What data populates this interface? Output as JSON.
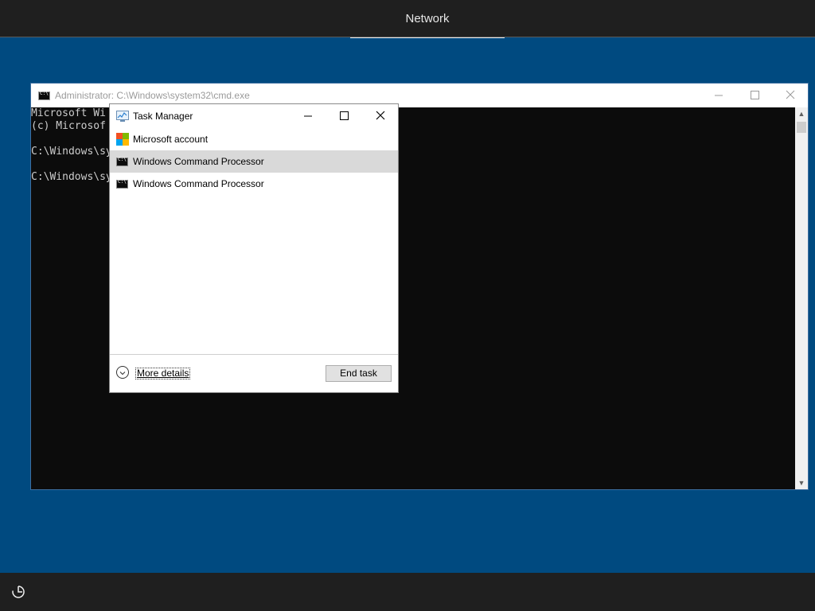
{
  "top_bar": {
    "tab_label": "Network"
  },
  "cmd_window": {
    "title": "Administrator: C:\\Windows\\system32\\cmd.exe",
    "lines": [
      "Microsoft Wi",
      "(c) Microsof",
      "",
      "C:\\Windows\\sy",
      "",
      "C:\\Windows\\sy"
    ]
  },
  "task_manager": {
    "title": "Task Manager",
    "items": [
      {
        "label": "Microsoft account",
        "icon": "microsoft-logo-icon",
        "selected": false
      },
      {
        "label": "Windows Command Processor",
        "icon": "cmd-icon",
        "selected": true
      },
      {
        "label": "Windows Command Processor",
        "icon": "cmd-icon",
        "selected": false
      }
    ],
    "more_details_label": "More details",
    "end_task_label": "End task"
  },
  "bottom_bar": {
    "ease_of_access_icon": "ease-of-access-icon"
  }
}
